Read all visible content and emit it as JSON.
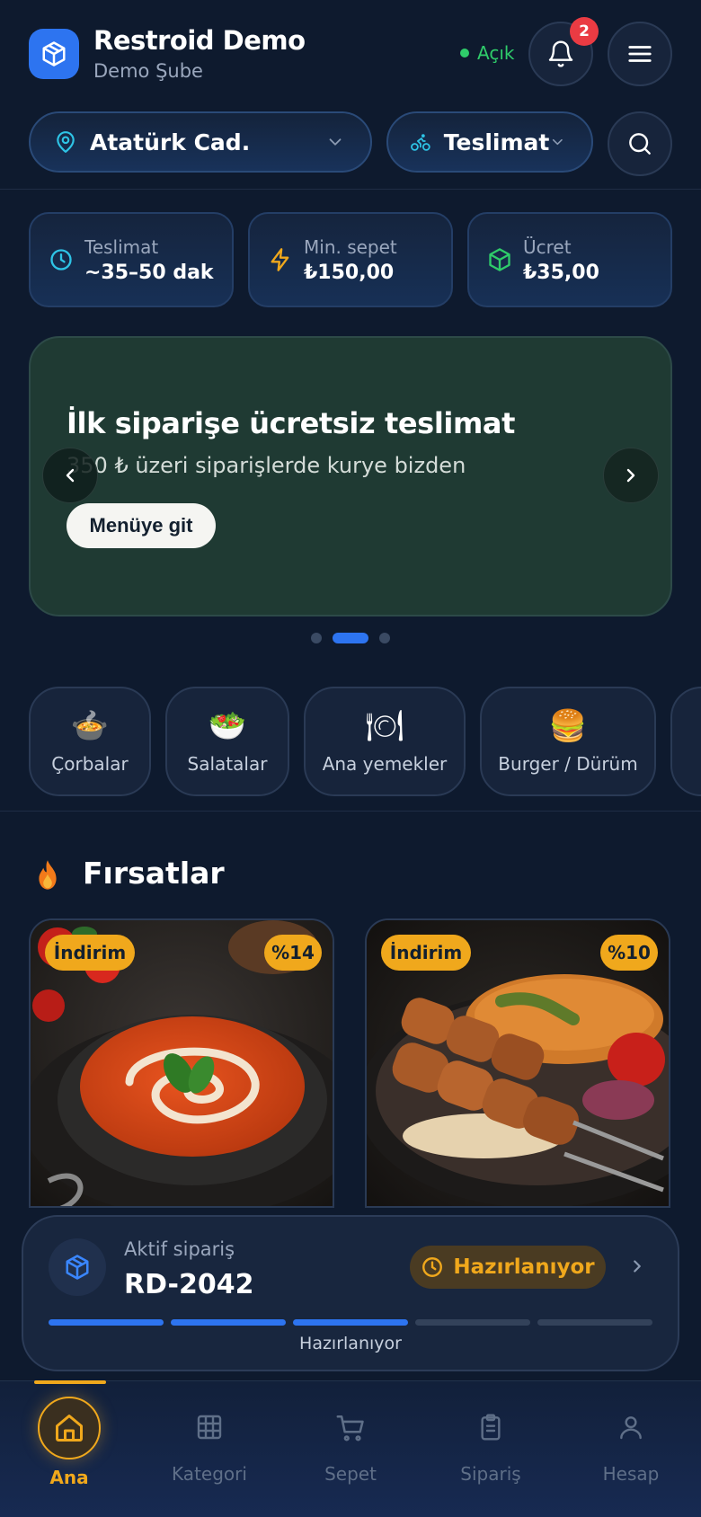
{
  "header": {
    "app_title": "Restroid Demo",
    "branch": "Demo Şube",
    "status": "Açık",
    "notification_count": "2",
    "status_color": "#2fcc6a"
  },
  "filters": {
    "address": "Atatürk Cad.",
    "delivery_mode": "Teslimat"
  },
  "info": [
    {
      "label": "Teslimat",
      "value": "~35–50 dak",
      "icon": "clock-icon"
    },
    {
      "label": "Min. sepet",
      "value": "₺150,00",
      "icon": "lightning-icon"
    },
    {
      "label": "Ücret",
      "value": "₺35,00",
      "icon": "package-icon"
    }
  ],
  "banner": {
    "title": "İlk siparişe ücretsiz teslimat",
    "subtitle": "350 ₺ üzeri siparişlerde kurye bizden",
    "button": "Menüye git",
    "active_slide": 2,
    "slide_count": 3
  },
  "categories": [
    {
      "label": "Çorbalar",
      "emoji": "🍲"
    },
    {
      "label": "Salatalar",
      "emoji": "🥗"
    },
    {
      "label": "Ana yemekler",
      "emoji": "🍽"
    },
    {
      "label": "Burger / Dürüm",
      "emoji": "🍔"
    }
  ],
  "deals": {
    "title": "Fırsatlar",
    "items": [
      {
        "tag": "İndirim",
        "discount": "%14",
        "image": "tomato-soup-photo"
      },
      {
        "tag": "İndirim",
        "discount": "%10",
        "image": "kebab-plate-photo"
      }
    ]
  },
  "active_order": {
    "label": "Aktif sipariş",
    "id": "RD-2042",
    "status": "Hazırlanıyor",
    "progress_label": "Hazırlanıyor",
    "steps_total": 5,
    "steps_done": 3
  },
  "nav": {
    "items": [
      {
        "label": "Ana",
        "icon": "home-icon",
        "active": true
      },
      {
        "label": "Kategori",
        "icon": "grid-icon",
        "active": false
      },
      {
        "label": "Sepet",
        "icon": "cart-icon",
        "active": false
      },
      {
        "label": "Sipariş",
        "icon": "clipboard-icon",
        "active": false
      },
      {
        "label": "Hesap",
        "icon": "user-icon",
        "active": false
      }
    ]
  },
  "colors": {
    "accent_blue": "#2d74f0",
    "accent_orange": "#f0a81c",
    "background": "#0e1a2e"
  }
}
